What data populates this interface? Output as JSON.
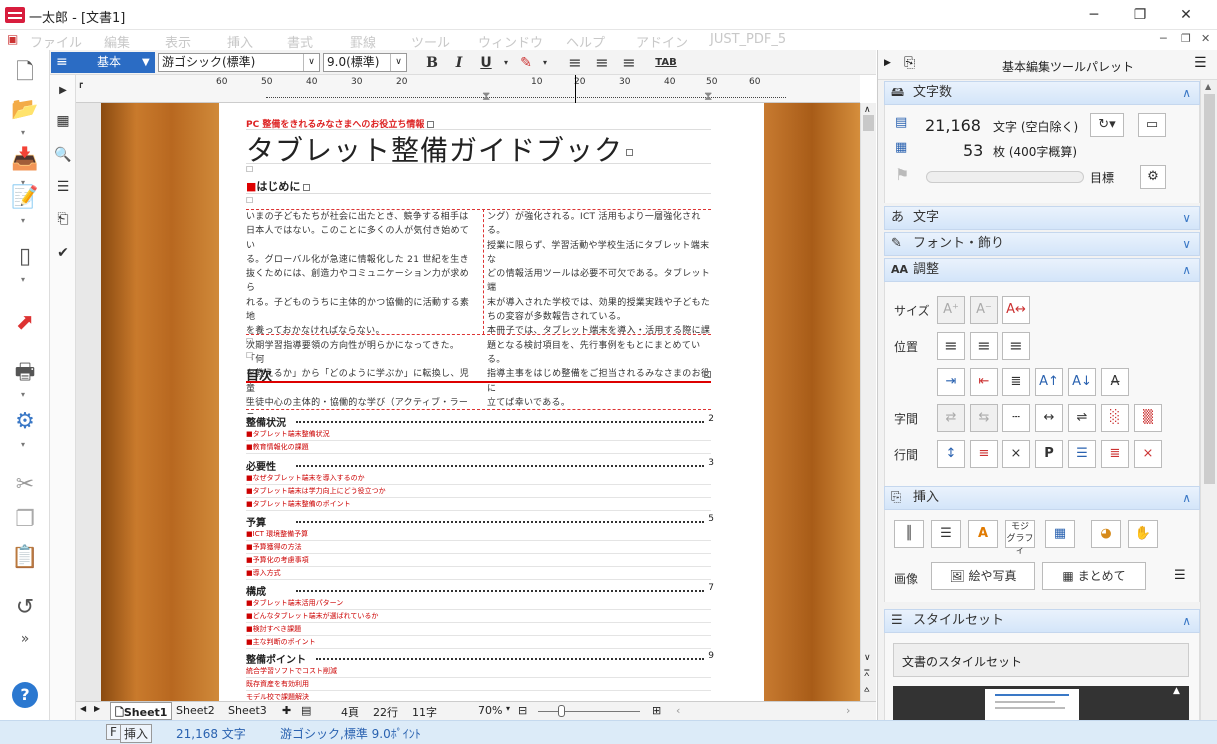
{
  "window": {
    "app_name": "一太郎",
    "doc_title": "[文書1]",
    "title": "一太郎 - [文書1]"
  },
  "menu": [
    "ファイル",
    "編集",
    "表示",
    "挿入",
    "書式",
    "罫線",
    "ツール",
    "ウィンドウ",
    "ヘルプ",
    "アドイン",
    "JUST_PDF_5"
  ],
  "format_bar": {
    "style": "基本",
    "font": "游ゴシック(標準)",
    "size": "9.0(標準)",
    "bold": "B",
    "italic": "I",
    "underline": "U",
    "tab": "TAB"
  },
  "ruler": {
    "labels": [
      "60",
      "50",
      "40",
      "30",
      "20",
      "10",
      "",
      "10",
      "20",
      "30",
      "40",
      "50",
      "60"
    ]
  },
  "doc": {
    "header_note": "PC 整備をきれるみなさまへのお役立ち情報",
    "title": "タブレット整備ガイドブック",
    "intro_heading": "はじめに",
    "col1": [
      "いまの子どもたちが社会に出たとき、競争する相手は",
      "日本人ではない。このことに多くの人が気付き始めてい",
      "る。グローバル化が急速に情報化した 21 世紀を生き",
      "抜くためには、創造力やコミュニケーション力が求めら",
      "れる。子どものうちに主体的かつ協働的に活動する素地",
      "を養っておかなければならない。",
      "次期学習指導要領の方向性が明らかになってきた。「何",
      "を教えるか」から「どのように学ぶか」に転換し、児童",
      "生徒中心の主体的・協働的な学び（アクティブ・ラーニ"
    ],
    "col2": [
      "ング）が強化される。ICT 活用もより一層強化される。",
      "授業に限らず、学習活動や学校生活にタブレット端末な",
      "どの情報活用ツールは必要不可欠である。タブレット端",
      "末が導入された学校では、効果的授業実践や子どもた",
      "ちの変容が多数報告されている。",
      "本冊子では、タブレット端末を導入・活用する際に課",
      "題となる検討項目を、先行事例をもとにまとめている。",
      "指導主事をはじめ整備をご担当されるみなさまのお役に",
      "立てば幸いである。"
    ],
    "toc_heading": "目次",
    "toc": [
      {
        "title": "整備状況",
        "page": "2",
        "items": [
          "タブレット端末整備状況",
          "教育情報化の課題"
        ]
      },
      {
        "title": "必要性",
        "page": "3",
        "items": [
          "なぜタブレット端末を導入するのか",
          "タブレット端末は学力向上にどう役立つか",
          "タブレット端末整備のポイント"
        ]
      },
      {
        "title": "予算",
        "page": "5",
        "items": [
          "ICT 環境整備予算",
          "予算獲得の方法",
          "予算化の考慮事項",
          "導入方式"
        ]
      },
      {
        "title": "構成",
        "page": "7",
        "items": [
          "タブレット端末活用パターン",
          "どんなタブレット端末が選ばれているか",
          "検討すべき課題",
          "主な判断のポイント"
        ]
      },
      {
        "title": "整備ポイント",
        "page": "9",
        "items": [
          "統合学習ソフトでコスト削減",
          "既存資産を有効利用",
          "モデル校で課題解決"
        ]
      }
    ]
  },
  "sheets": [
    "Sheet1",
    "Sheet2",
    "Sheet3"
  ],
  "sheet_status": {
    "page": "4頁",
    "line": "22行",
    "char": "11字",
    "zoom": "70%"
  },
  "status": {
    "key": "F",
    "mode": "挿入",
    "count": "21,168 文字",
    "font": "游ゴシック,標準 9.0ﾎﾟｲﾝﾄ"
  },
  "panel": {
    "title": "基本編集ツールパレット",
    "char_count": {
      "header": "文字数",
      "chars": "21,168",
      "chars_unit": "文字 (空白除く)",
      "sheets": "53",
      "sheets_unit": "枚 (400字概算)",
      "goal": "目標"
    },
    "sec_char": "文字",
    "sec_font": "フォント・飾り",
    "sec_adjust": "調整",
    "adjust_labels": {
      "size": "サイズ",
      "position": "位置",
      "spacing": "字間",
      "linespacing": "行間"
    },
    "sec_insert": "挿入",
    "insert": {
      "image_label": "画像",
      "btn_picture": "絵や写真",
      "btn_together": "まとめて"
    },
    "sec_style": "スタイルセット",
    "style_label": "文書のスタイルセット"
  },
  "colors": {
    "accent": "#2b6cc4",
    "red": "#d81d3d",
    "panel_header": "#d4e5f9"
  }
}
